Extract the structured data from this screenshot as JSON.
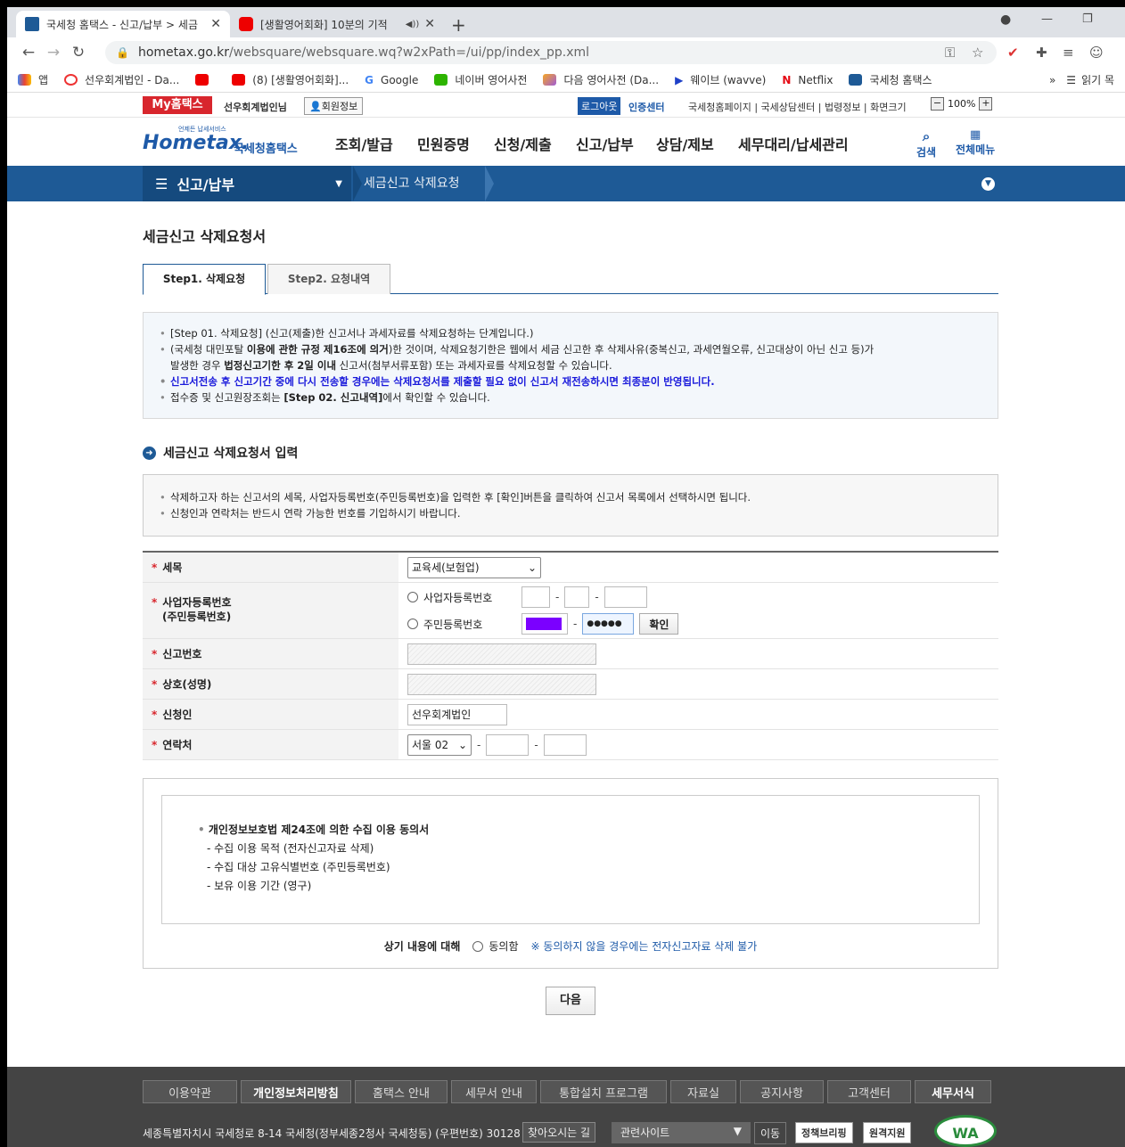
{
  "browser": {
    "tabs": [
      {
        "title": "국세청 홈택스 - 신고/납부 > 세금",
        "active": true
      },
      {
        "title": "[생활영어회화] 10분의 기적",
        "active": false
      }
    ],
    "url_host": "hometax.go.kr",
    "url_path": "/websquare/websquare.wq?w2xPath=/ui/pp/index_pp.xml",
    "bookmarks": [
      "앱",
      "선우회계법인 - Da...",
      "",
      "(8) [생활영어회화]...",
      "Google",
      "네이버 영어사전",
      "다음 영어사전 (Da...",
      "웨이브 (wavve)",
      "Netflix",
      "국세청 홈택스"
    ],
    "reading_list": "읽기 목"
  },
  "topbar": {
    "my": "My홈택스",
    "user": "선우회계법인님",
    "member_info": "회원정보",
    "logout": "로그아웃",
    "cert": "인증센터",
    "links": "국세청홈페이지 | 국세상담센터 | 법령정보 | 화면크기",
    "zoom": "100%"
  },
  "gnb": {
    "logo_top": "언제든 납세서비스",
    "logo_main": "Hometax.",
    "logo_sub": "국세청홈택스",
    "menu": [
      "조회/발급",
      "민원증명",
      "신청/제출",
      "신고/납부",
      "상담/제보",
      "세무대리/납세관리"
    ],
    "search": "검색",
    "allmenu": "전체메뉴"
  },
  "lnb": {
    "section": "신고/납부",
    "current": "세금신고 삭제요청"
  },
  "page": {
    "title": "세금신고 삭제요청서",
    "tabs": [
      "Step1. 삭제요청",
      "Step2. 요청내역"
    ],
    "info": {
      "l1": "[Step 01. 삭제요청] (신고(제출)한 신고서나 과세자료를 삭제요청하는 단계입니다.)",
      "l2a": "(국세청 대민포탈 ",
      "l2b": "이용에 관한 규정 제16조에 의거",
      "l2c": ")한 것이며, 삭제요청기한은 웹에서 세금 신고한 후 삭제사유(중복신고, 과세연월오류, 신고대상이 아닌 신고 등)가",
      "l2d": "발생한 경우 ",
      "l2e": "법정신고기한 후 2일 이내",
      "l2f": " 신고서(첨부서류포함) 또는 과세자료를 삭제요청할 수 있습니다.",
      "l3": "신고서전송 후 신고기간 중에 다시 전송할 경우에는 삭제요청서를 제출할 필요 없이 신고서 재전송하시면 최종분이 반영됩니다.",
      "l4a": "접수증 및 신고원장조회는 ",
      "l4b": "[Step 02. 신고내역]",
      "l4c": "에서 확인할 수 있습니다."
    },
    "section_title": "세금신고 삭제요청서 입력",
    "info2": [
      "삭제하고자 하는 신고서의 세목, 사업자등록번호(주민등록번호)을 입력한 후 [확인]버튼을 클릭하여 신고서 목록에서 선택하시면 됩니다.",
      "신청인과 연락처는 반드시 연락 가능한 번호를 기입하시기 바랍니다."
    ],
    "form": {
      "tax_label": "세목",
      "tax_value": "교육세(보험업)",
      "bizno_label": "사업자등록번호",
      "bizno_label2": "(주민등록번호)",
      "opt_biz": "사업자등록번호",
      "opt_rrn": "주민등록번호",
      "rrn_masked": "●●●●●",
      "confirm": "확인",
      "report_no": "신고번호",
      "company": "상호(성명)",
      "applicant": "신청인",
      "applicant_value": "선우회계법인",
      "contact": "연락처",
      "area_code": "서울 02",
      "masked_color": "#7b00ff"
    },
    "consent": {
      "head": "개인정보보호법 제24조에 의한 수집 이용 동의서",
      "items": [
        "- 수집 이용 목적 (전자신고자료 삭제)",
        "- 수집 대상 고유식별번호 (주민등록번호)",
        "- 보유 이용 기간 (영구)"
      ],
      "agree_label": "상기 내용에 대해",
      "agree_opt": "동의함",
      "note": "※ 동의하지 않을 경우에는 전자신고자료 삭제 불가"
    },
    "next": "다음"
  },
  "footer": {
    "links": [
      "이용약관",
      "개인정보처리방침",
      "홈택스 안내",
      "세무서 안내",
      "통합설치 프로그램",
      "자료실",
      "공지사항",
      "고객센터",
      "세무서식"
    ],
    "address": "세종특별자치시 국세청로 8-14 국세청(정부세종2청사 국세청동) (우편번호) 30128",
    "findway": "찾아오시는 길",
    "related": "관련사이트",
    "move": "이동",
    "policy": "정책브리핑",
    "remote": "원격지원",
    "wa": "WA"
  },
  "colors": {
    "brand_blue": "#1e5a96",
    "my_red": "#d8262d"
  }
}
